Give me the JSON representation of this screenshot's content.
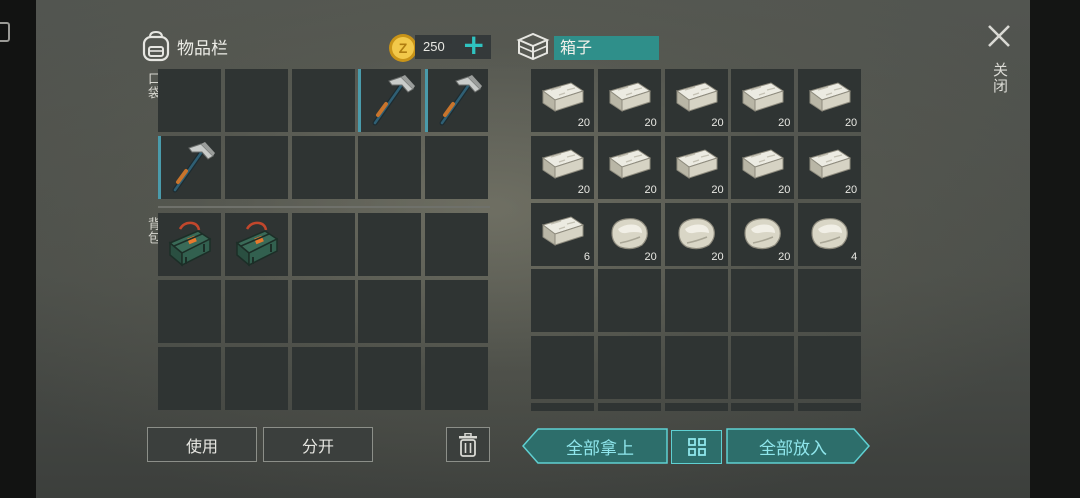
{
  "inventory": {
    "title": "物品栏",
    "coins": "250",
    "add_label": "+",
    "pocket_label": "口袋",
    "backpack_label": "背包",
    "pocket_slots": [
      {
        "item": "empty"
      },
      {
        "item": "empty"
      },
      {
        "item": "empty"
      },
      {
        "item": "pickaxe",
        "selected": true
      },
      {
        "item": "pickaxe",
        "selected": true
      },
      {
        "item": "pickaxe",
        "selected": true
      },
      {
        "item": "empty"
      },
      {
        "item": "empty"
      },
      {
        "item": "empty"
      },
      {
        "item": "empty"
      }
    ],
    "backpack_slots": [
      {
        "item": "toolbox"
      },
      {
        "item": "toolbox"
      },
      {
        "item": "empty"
      },
      {
        "item": "empty"
      },
      {
        "item": "empty"
      },
      {
        "item": "empty"
      },
      {
        "item": "empty"
      },
      {
        "item": "empty"
      },
      {
        "item": "empty"
      },
      {
        "item": "empty"
      },
      {
        "item": "empty"
      },
      {
        "item": "empty"
      },
      {
        "item": "empty"
      },
      {
        "item": "empty"
      },
      {
        "item": "empty"
      }
    ],
    "use_label": "使用",
    "split_label": "分开"
  },
  "box": {
    "title": "箱子",
    "slots": [
      {
        "item": "stone-block",
        "count": "20"
      },
      {
        "item": "stone-block",
        "count": "20"
      },
      {
        "item": "stone-block",
        "count": "20"
      },
      {
        "item": "stone-block",
        "count": "20"
      },
      {
        "item": "stone-block",
        "count": "20"
      },
      {
        "item": "stone-block",
        "count": "20"
      },
      {
        "item": "stone-block",
        "count": "20"
      },
      {
        "item": "stone-block",
        "count": "20"
      },
      {
        "item": "stone-block",
        "count": "20"
      },
      {
        "item": "stone-block",
        "count": "20"
      },
      {
        "item": "stone-block",
        "count": "6"
      },
      {
        "item": "stone-rock",
        "count": "20"
      },
      {
        "item": "stone-rock",
        "count": "20"
      },
      {
        "item": "stone-rock",
        "count": "20"
      },
      {
        "item": "stone-rock",
        "count": "4"
      },
      {
        "item": "empty"
      },
      {
        "item": "empty"
      },
      {
        "item": "empty"
      },
      {
        "item": "empty"
      },
      {
        "item": "empty"
      },
      {
        "item": "empty"
      },
      {
        "item": "empty"
      },
      {
        "item": "empty"
      },
      {
        "item": "empty"
      },
      {
        "item": "empty"
      },
      {
        "item": "empty"
      },
      {
        "item": "empty"
      },
      {
        "item": "empty"
      },
      {
        "item": "empty"
      },
      {
        "item": "empty"
      }
    ],
    "take_all_label": "全部拿上",
    "put_all_label": "全部放入"
  },
  "close_label": "关闭",
  "icons": {
    "backpack": "backpack-icon",
    "coin": "coin-icon",
    "box": "box-icon",
    "close": "close-icon",
    "trash": "trash-icon",
    "sort": "sort-grid-icon"
  },
  "colors": {
    "accent_teal": "#2f8f8a",
    "slot_bg": "#2f3433",
    "count_text": "#e8e8e3"
  }
}
